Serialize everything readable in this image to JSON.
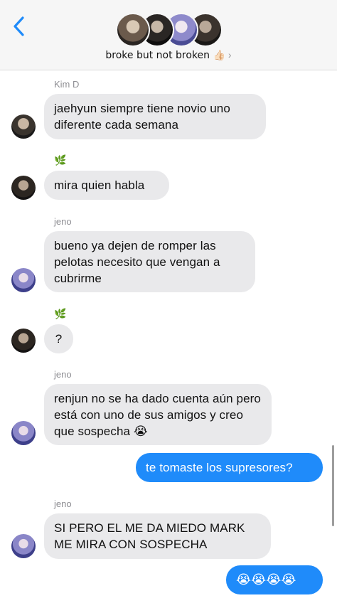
{
  "header": {
    "group_name": "broke but not broken 👍🏻",
    "chevron": "›",
    "back_icon": "chevron-left-icon"
  },
  "messages": [
    {
      "sender": "Kim D",
      "text": "jaehyun siempre tiene novio uno diferente cada semana"
    },
    {
      "sender_icon": "🌿",
      "text": "mira quien habla"
    },
    {
      "sender": "jeno",
      "text": "bueno ya dejen de romper las pelotas necesito que vengan a cubrirme"
    },
    {
      "sender_icon": "🌿",
      "text": "?"
    },
    {
      "sender": "jeno",
      "text": "renjun no se ha dado cuenta aún pero está con uno de sus amigos y creo que sospecha 😭"
    },
    {
      "outgoing": true,
      "text": "te tomaste los supresores?"
    },
    {
      "sender": "jeno",
      "text": "SI PERO EL ME DA MIEDO MARK ME MIRA CON SOSPECHA"
    },
    {
      "outgoing": true,
      "text": "😭😭😭😭"
    }
  ],
  "colors": {
    "incoming_bubble": "#e9e9eb",
    "outgoing_bubble": "#1f8bfa",
    "accent": "#1f8bfa"
  }
}
